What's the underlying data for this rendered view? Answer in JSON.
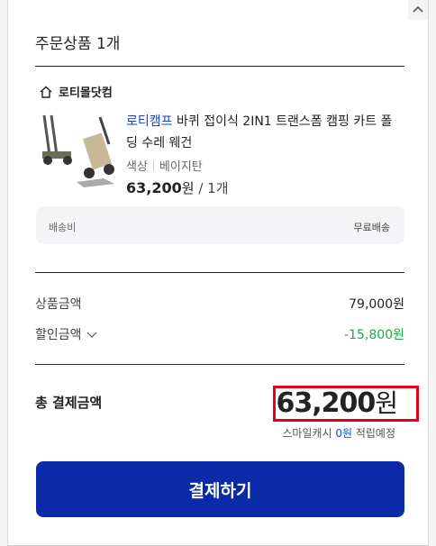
{
  "order": {
    "header": "주문상품 1개",
    "store": {
      "name": "로티몰닷컴",
      "icon": "home-icon"
    },
    "item": {
      "brand": "로티캠프",
      "title": " 바퀴 접이식 2IN1 트랜스폼 캠핑 카트 폴딩 수레 웨건",
      "option_name": "색상",
      "option_value": "베이지탄",
      "price": "63,200",
      "price_unit": "원",
      "quantity": " / 1개"
    },
    "shipping": {
      "label": "배송비",
      "value": "무료배송"
    }
  },
  "summary": {
    "product_amount_label": "상품금액",
    "product_amount": "79,000원",
    "discount_label": "할인금액",
    "discount_amount": "-15,800원",
    "total_label": "총 결제금액",
    "total_amount": "63,200",
    "total_unit": "원",
    "points_prefix": "스마일캐시 ",
    "points_value": "0원",
    "points_suffix": " 적립예정"
  },
  "pay_button_label": "결제하기",
  "colors": {
    "accent": "#0b2aa8",
    "discount": "#1aaa4b",
    "highlight": "#e3001b",
    "brand_link": "#1a3fcf"
  }
}
